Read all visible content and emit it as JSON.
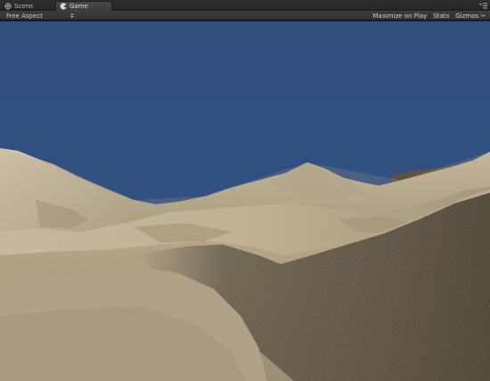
{
  "tabs": [
    {
      "label": "Scene",
      "icon": "crosshair-icon"
    },
    {
      "label": "Game",
      "icon": "pacman-icon",
      "active": true
    }
  ],
  "toolbar": {
    "aspect_label": "Free Aspect",
    "maximize_label": "Maximize on Play",
    "stats_label": "Stats",
    "gizmos_label": "Gizmos"
  },
  "colors": {
    "sky": "#304f7d",
    "sand_light": "#d6c8ab",
    "sand_mid": "#b6a586",
    "sand_shadow": "#4a4235",
    "editor_bg": "#282828"
  }
}
